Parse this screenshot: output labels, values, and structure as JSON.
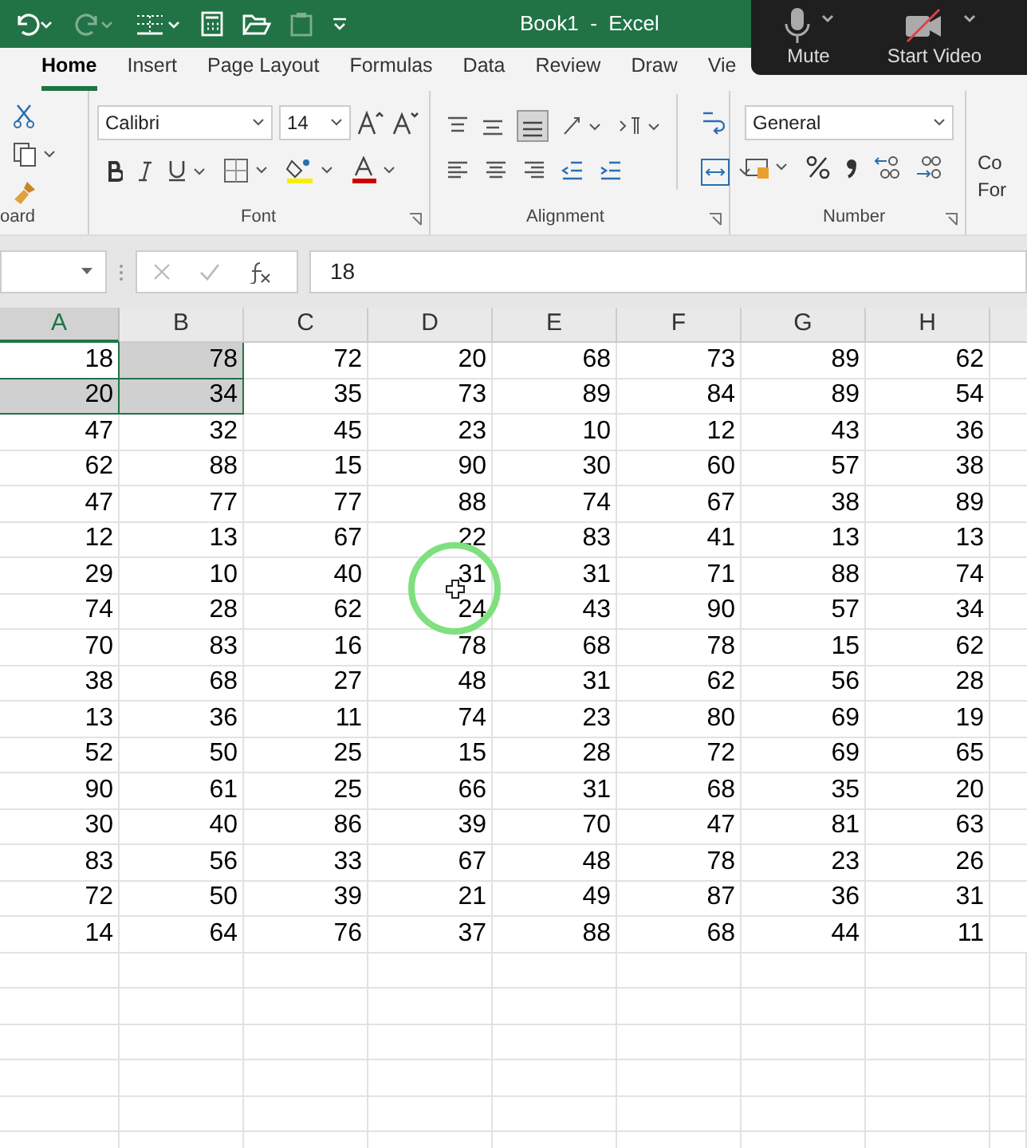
{
  "title_bar": {
    "title": "Book1  -  Excel"
  },
  "meeting_controls": [
    {
      "kind": "mic",
      "label": "Mute"
    },
    {
      "kind": "video",
      "label": "Start Video"
    }
  ],
  "ribbon_tabs": [
    {
      "label": "Home",
      "selected": true
    },
    {
      "label": "Insert",
      "selected": false
    },
    {
      "label": "Page Layout",
      "selected": false
    },
    {
      "label": "Formulas",
      "selected": false
    },
    {
      "label": "Data",
      "selected": false
    },
    {
      "label": "Review",
      "selected": false
    },
    {
      "label": "Draw",
      "selected": false
    },
    {
      "label": "Vie",
      "selected": false
    }
  ],
  "ribbon": {
    "font_name": "Calibri",
    "font_size": "14",
    "number_format": "General",
    "groups": [
      "oard",
      "Font",
      "Alignment",
      "Number"
    ],
    "conditional_formatting": [
      "Co",
      "For"
    ]
  },
  "formula_bar": {
    "value": "18"
  },
  "sheet": {
    "columns": [
      {
        "label": "A",
        "selected": true
      },
      {
        "label": "B",
        "selected": false
      },
      {
        "label": "C",
        "selected": false
      },
      {
        "label": "D",
        "selected": false
      },
      {
        "label": "E",
        "selected": false
      },
      {
        "label": "F",
        "selected": false
      },
      {
        "label": "G",
        "selected": false
      },
      {
        "label": "H",
        "selected": false
      }
    ],
    "rows": [
      {
        "cells": [
          {
            "value": "18",
            "selected": true
          },
          {
            "value": "78",
            "selected": true
          },
          {
            "value": "72",
            "selected": false
          },
          {
            "value": "20",
            "selected": false
          },
          {
            "value": "68",
            "selected": false
          },
          {
            "value": "73",
            "selected": false
          },
          {
            "value": "89",
            "selected": false
          },
          {
            "value": "62",
            "selected": false
          }
        ]
      },
      {
        "cells": [
          {
            "value": "20",
            "selected": true
          },
          {
            "value": "34",
            "selected": true
          },
          {
            "value": "35",
            "selected": false
          },
          {
            "value": "73",
            "selected": false
          },
          {
            "value": "89",
            "selected": false
          },
          {
            "value": "84",
            "selected": false
          },
          {
            "value": "89",
            "selected": false
          },
          {
            "value": "54",
            "selected": false
          }
        ]
      },
      {
        "cells": [
          {
            "value": "47",
            "selected": false
          },
          {
            "value": "32",
            "selected": false
          },
          {
            "value": "45",
            "selected": false
          },
          {
            "value": "23",
            "selected": false
          },
          {
            "value": "10",
            "selected": false
          },
          {
            "value": "12",
            "selected": false
          },
          {
            "value": "43",
            "selected": false
          },
          {
            "value": "36",
            "selected": false
          }
        ]
      },
      {
        "cells": [
          {
            "value": "62",
            "selected": false
          },
          {
            "value": "88",
            "selected": false
          },
          {
            "value": "15",
            "selected": false
          },
          {
            "value": "90",
            "selected": false
          },
          {
            "value": "30",
            "selected": false
          },
          {
            "value": "60",
            "selected": false
          },
          {
            "value": "57",
            "selected": false
          },
          {
            "value": "38",
            "selected": false
          }
        ]
      },
      {
        "cells": [
          {
            "value": "47",
            "selected": false
          },
          {
            "value": "77",
            "selected": false
          },
          {
            "value": "77",
            "selected": false
          },
          {
            "value": "88",
            "selected": false
          },
          {
            "value": "74",
            "selected": false
          },
          {
            "value": "67",
            "selected": false
          },
          {
            "value": "38",
            "selected": false
          },
          {
            "value": "89",
            "selected": false
          }
        ]
      },
      {
        "cells": [
          {
            "value": "12",
            "selected": false
          },
          {
            "value": "13",
            "selected": false
          },
          {
            "value": "67",
            "selected": false
          },
          {
            "value": "22",
            "selected": false
          },
          {
            "value": "83",
            "selected": false
          },
          {
            "value": "41",
            "selected": false
          },
          {
            "value": "13",
            "selected": false
          },
          {
            "value": "13",
            "selected": false
          }
        ]
      },
      {
        "cells": [
          {
            "value": "29",
            "selected": false
          },
          {
            "value": "10",
            "selected": false
          },
          {
            "value": "40",
            "selected": false
          },
          {
            "value": "31",
            "selected": false
          },
          {
            "value": "31",
            "selected": false
          },
          {
            "value": "71",
            "selected": false
          },
          {
            "value": "88",
            "selected": false
          },
          {
            "value": "74",
            "selected": false
          }
        ]
      },
      {
        "cells": [
          {
            "value": "74",
            "selected": false
          },
          {
            "value": "28",
            "selected": false
          },
          {
            "value": "62",
            "selected": false
          },
          {
            "value": "24",
            "selected": false
          },
          {
            "value": "43",
            "selected": false
          },
          {
            "value": "90",
            "selected": false
          },
          {
            "value": "57",
            "selected": false
          },
          {
            "value": "34",
            "selected": false
          }
        ]
      },
      {
        "cells": [
          {
            "value": "70",
            "selected": false
          },
          {
            "value": "83",
            "selected": false
          },
          {
            "value": "16",
            "selected": false
          },
          {
            "value": "78",
            "selected": false
          },
          {
            "value": "68",
            "selected": false
          },
          {
            "value": "78",
            "selected": false
          },
          {
            "value": "15",
            "selected": false
          },
          {
            "value": "62",
            "selected": false
          }
        ]
      },
      {
        "cells": [
          {
            "value": "38",
            "selected": false
          },
          {
            "value": "68",
            "selected": false
          },
          {
            "value": "27",
            "selected": false
          },
          {
            "value": "48",
            "selected": false
          },
          {
            "value": "31",
            "selected": false
          },
          {
            "value": "62",
            "selected": false
          },
          {
            "value": "56",
            "selected": false
          },
          {
            "value": "28",
            "selected": false
          }
        ]
      },
      {
        "cells": [
          {
            "value": "13",
            "selected": false
          },
          {
            "value": "36",
            "selected": false
          },
          {
            "value": "11",
            "selected": false
          },
          {
            "value": "74",
            "selected": false
          },
          {
            "value": "23",
            "selected": false
          },
          {
            "value": "80",
            "selected": false
          },
          {
            "value": "69",
            "selected": false
          },
          {
            "value": "19",
            "selected": false
          }
        ]
      },
      {
        "cells": [
          {
            "value": "52",
            "selected": false
          },
          {
            "value": "50",
            "selected": false
          },
          {
            "value": "25",
            "selected": false
          },
          {
            "value": "15",
            "selected": false
          },
          {
            "value": "28",
            "selected": false
          },
          {
            "value": "72",
            "selected": false
          },
          {
            "value": "69",
            "selected": false
          },
          {
            "value": "65",
            "selected": false
          }
        ]
      },
      {
        "cells": [
          {
            "value": "90",
            "selected": false
          },
          {
            "value": "61",
            "selected": false
          },
          {
            "value": "25",
            "selected": false
          },
          {
            "value": "66",
            "selected": false
          },
          {
            "value": "31",
            "selected": false
          },
          {
            "value": "68",
            "selected": false
          },
          {
            "value": "35",
            "selected": false
          },
          {
            "value": "20",
            "selected": false
          }
        ]
      },
      {
        "cells": [
          {
            "value": "30",
            "selected": false
          },
          {
            "value": "40",
            "selected": false
          },
          {
            "value": "86",
            "selected": false
          },
          {
            "value": "39",
            "selected": false
          },
          {
            "value": "70",
            "selected": false
          },
          {
            "value": "47",
            "selected": false
          },
          {
            "value": "81",
            "selected": false
          },
          {
            "value": "63",
            "selected": false
          }
        ]
      },
      {
        "cells": [
          {
            "value": "83",
            "selected": false
          },
          {
            "value": "56",
            "selected": false
          },
          {
            "value": "33",
            "selected": false
          },
          {
            "value": "67",
            "selected": false
          },
          {
            "value": "48",
            "selected": false
          },
          {
            "value": "78",
            "selected": false
          },
          {
            "value": "23",
            "selected": false
          },
          {
            "value": "26",
            "selected": false
          }
        ]
      },
      {
        "cells": [
          {
            "value": "72",
            "selected": false
          },
          {
            "value": "50",
            "selected": false
          },
          {
            "value": "39",
            "selected": false
          },
          {
            "value": "21",
            "selected": false
          },
          {
            "value": "49",
            "selected": false
          },
          {
            "value": "87",
            "selected": false
          },
          {
            "value": "36",
            "selected": false
          },
          {
            "value": "31",
            "selected": false
          }
        ]
      },
      {
        "cells": [
          {
            "value": "14",
            "selected": false
          },
          {
            "value": "64",
            "selected": false
          },
          {
            "value": "76",
            "selected": false
          },
          {
            "value": "37",
            "selected": false
          },
          {
            "value": "88",
            "selected": false
          },
          {
            "value": "68",
            "selected": false
          },
          {
            "value": "44",
            "selected": false
          },
          {
            "value": "11",
            "selected": false
          }
        ]
      }
    ]
  }
}
